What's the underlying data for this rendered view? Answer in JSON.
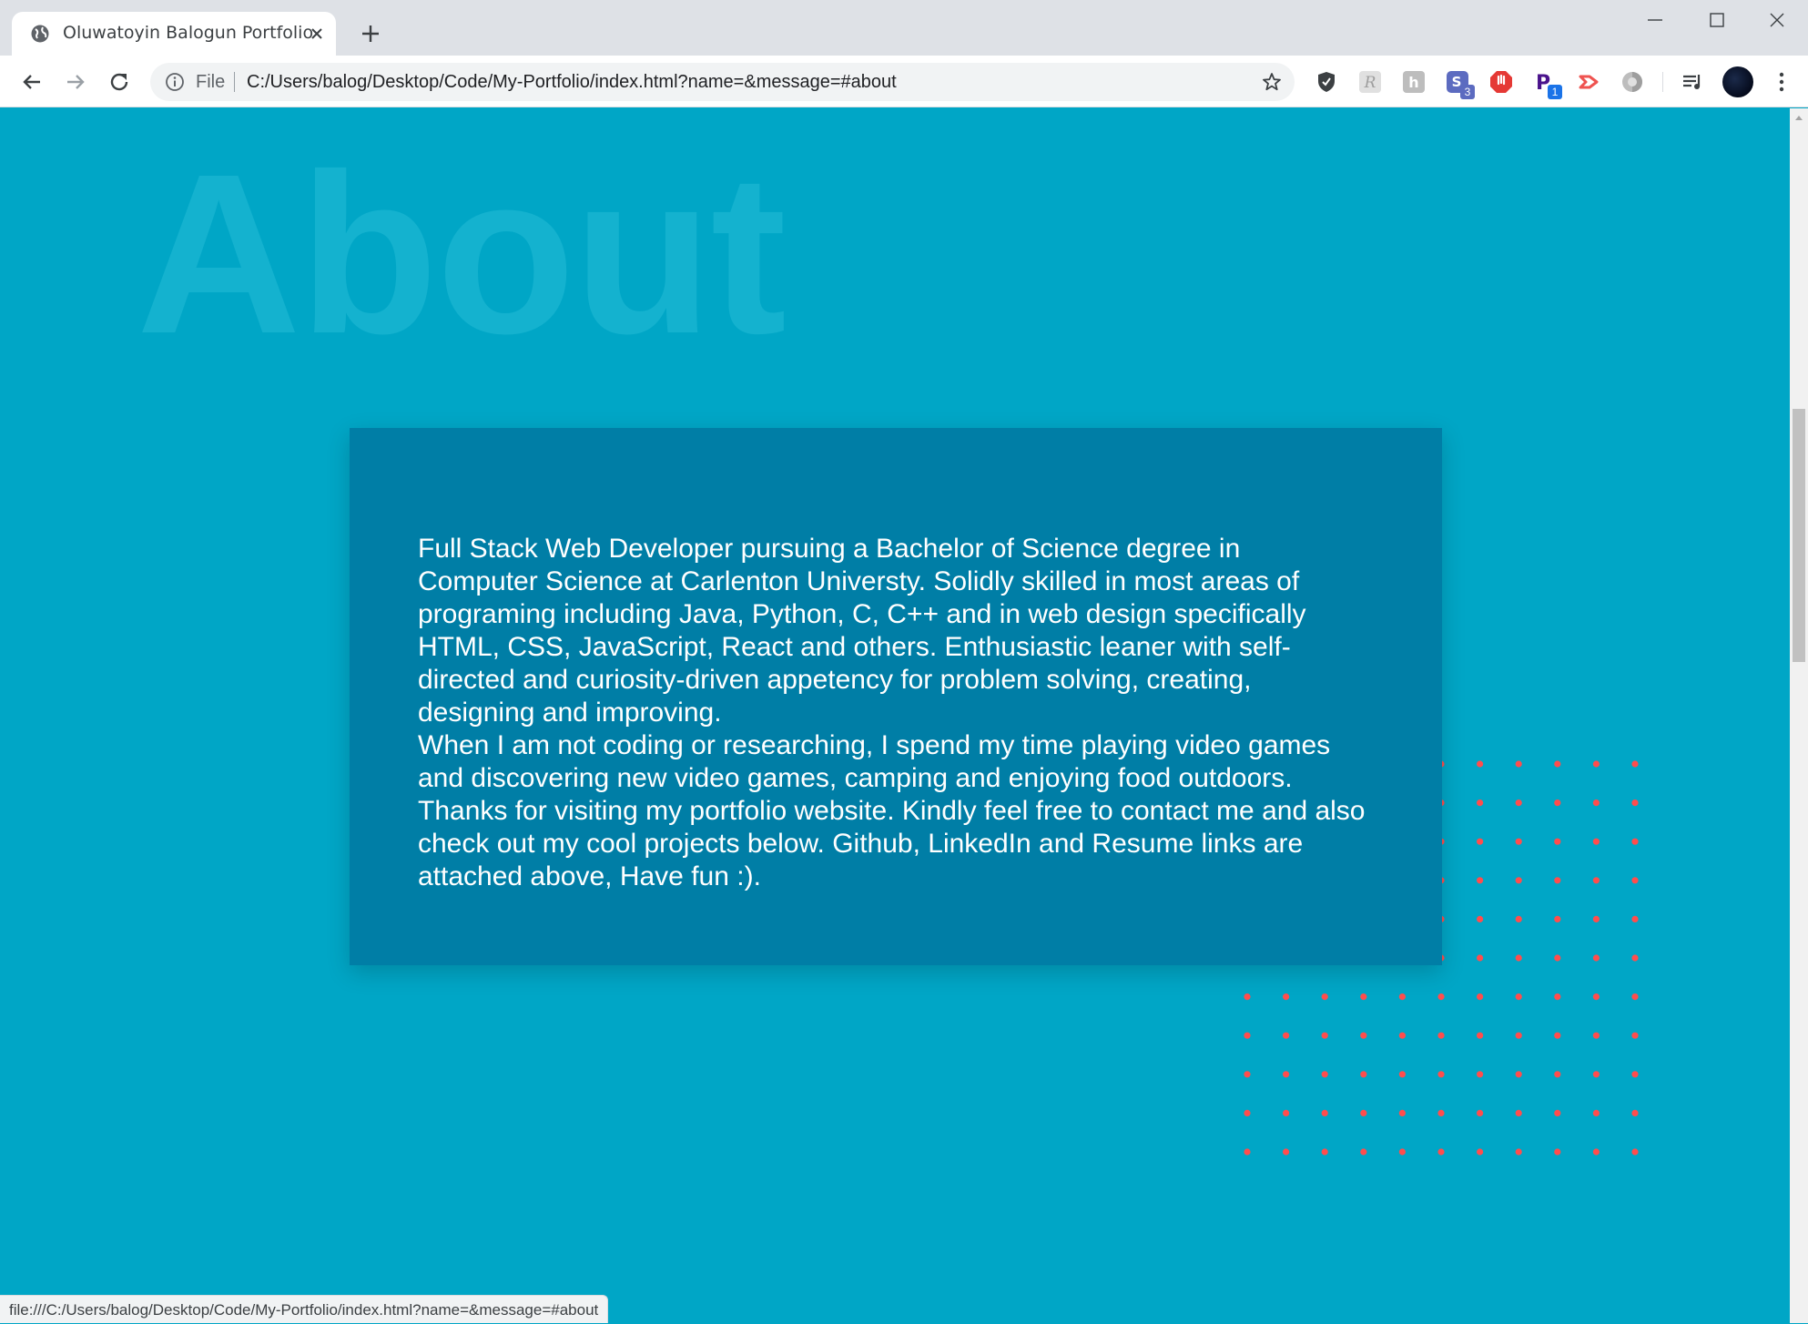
{
  "browser": {
    "tab": {
      "title": "Oluwatoyin Balogun Portfolio",
      "icon": "globe-icon"
    },
    "address": {
      "scheme_label": "File",
      "url": "C:/Users/balog/Desktop/Code/My-Portfolio/index.html?name=&message=#about"
    },
    "extensions": [
      {
        "name": "shield-extension-icon"
      },
      {
        "name": "script-r-extension-icon"
      },
      {
        "name": "h-extension-icon"
      },
      {
        "name": "s-extension-icon",
        "badge": "3"
      },
      {
        "name": "stop-extension-icon"
      },
      {
        "name": "p-extension-icon",
        "badge": "1"
      },
      {
        "name": "arrow-extension-icon"
      },
      {
        "name": "circle-extension-icon"
      }
    ],
    "status_url": "file:///C:/Users/balog/Desktop/Code/My-Portfolio/index.html?name=&message=#about"
  },
  "section": {
    "watermark": "About",
    "paragraphs": [
      "Full Stack Web Developer pursuing a Bachelor of Science degree in Computer Science at Carlenton Universty. Solidly skilled in most areas of programing including Java, Python, C, C++ and in web design specifically HTML, CSS, JavaScript, React and others. Enthusiastic leaner with self-directed and curiosity-driven appetency for problem solving, creating, designing and improving.",
      "When I am not coding or researching, I spend my time playing video games and discovering new video games, camping and enjoying food outdoors. Thanks for visiting my portfolio website. Kindly feel free to contact me and also check out my cool projects below. Github, LinkedIn and Resume links are attached above, Have fun :)."
    ]
  },
  "colors": {
    "page_bg": "#00a6c6",
    "card_bg": "#007ea6",
    "dot": "#ff4d4d",
    "watermark": "#14b2cf"
  }
}
